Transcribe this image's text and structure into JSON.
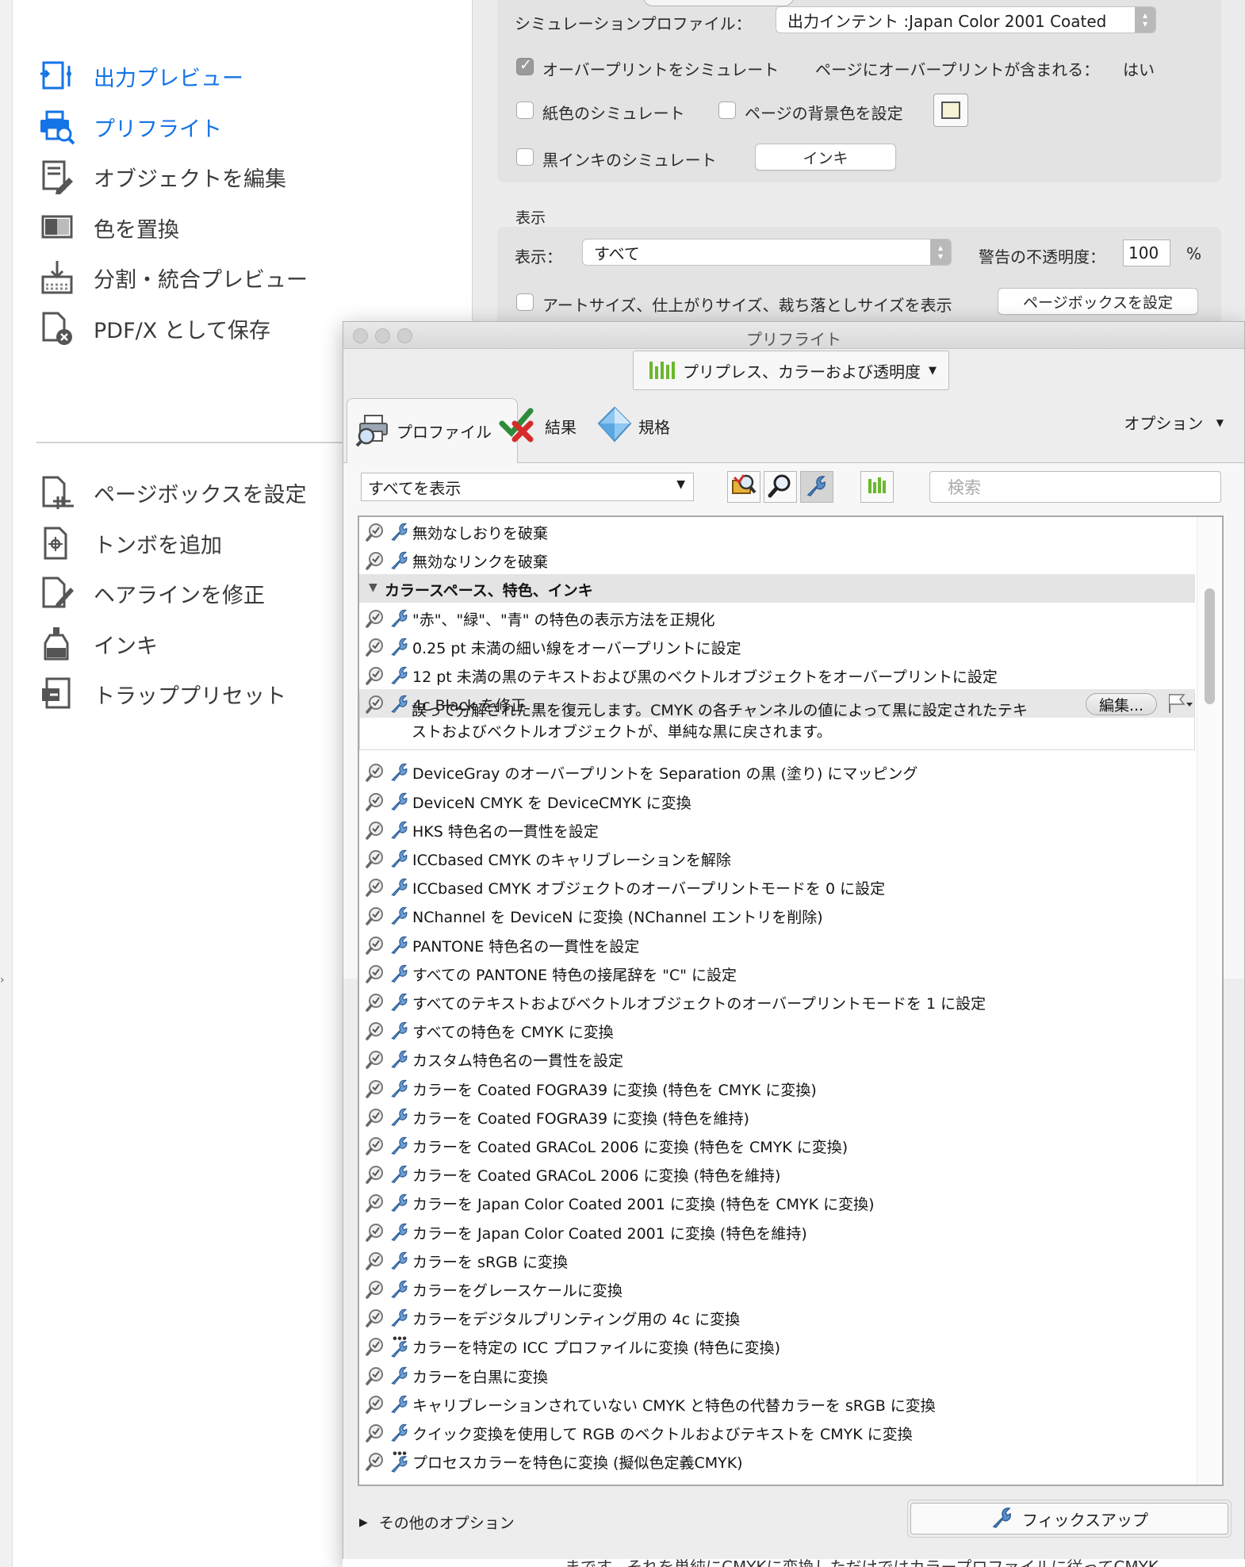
{
  "sidebar": {
    "items": [
      {
        "label": "出力プレビュー",
        "icon": "output-preview-icon",
        "active": true
      },
      {
        "label": "プリフライト",
        "icon": "preflight-icon",
        "active": true
      },
      {
        "label": "オブジェクトを編集",
        "icon": "edit-object-icon",
        "active": false
      },
      {
        "label": "色を置換",
        "icon": "replace-color-icon",
        "active": false
      },
      {
        "label": "分割・統合プレビュー",
        "icon": "flattener-preview-icon",
        "active": false
      },
      {
        "label": "PDF/X として保存",
        "icon": "save-pdfx-icon",
        "active": false
      },
      {
        "label": "ページボックスを設定",
        "icon": "page-box-icon",
        "active": false
      },
      {
        "label": "トンボを追加",
        "icon": "printer-marks-icon",
        "active": false
      },
      {
        "label": "ヘアラインを修正",
        "icon": "fix-hairline-icon",
        "active": false
      },
      {
        "label": "インキ",
        "icon": "ink-icon",
        "active": false
      },
      {
        "label": "トラッププリセット",
        "icon": "trap-preset-icon",
        "active": false
      }
    ],
    "accent": "#1473e6"
  },
  "output_preview": {
    "sim_profile_label": "シミュレーションプロファイル：",
    "sim_profile_value": "出力インテント :Japan Color 2001 Coated",
    "overprint_label": "オーバープリントをシミュレート",
    "overprint_checked": true,
    "contains_overprint_label": "ページにオーバープリントが含まれる：",
    "contains_overprint_value": "はい",
    "paper_color_label": "紙色のシミュレート",
    "page_bg_label": "ページの背景色を設定",
    "black_ink_label": "黒インキのシミュレート",
    "ink_button": "インキ",
    "display_section": "表示",
    "display_label": "表示：",
    "display_value": "すべて",
    "warning_opacity_label": "警告の不透明度：",
    "warning_opacity_value": "100",
    "percent": "%",
    "art_trim_label": "アートサイズ、仕上がりサイズ、裁ち落としサイズを表示",
    "page_box_button": "ページボックスを設定"
  },
  "preflight": {
    "window_title": "プリフライト",
    "profile_dropdown": "プリプレス、カラーおよび透明度",
    "tabs": [
      {
        "label": "プロファイル",
        "icon": "profile-icon"
      },
      {
        "label": "結果",
        "icon": "results-check-x-icon"
      },
      {
        "label": "規格",
        "icon": "standards-diamond-icon"
      }
    ],
    "options_label": "オプション",
    "show_filter": "すべてを表示",
    "search_placeholder": "検索",
    "rows": [
      {
        "text": "無効なしおりを破棄",
        "icon": "wrench"
      },
      {
        "text": "無効なリンクを破棄",
        "icon": "wrench"
      },
      {
        "text": "カラースペース、特色、インキ",
        "section": true
      },
      {
        "text": "\"赤\"、\"緑\"、\"青\" の特色の表示方法を正規化",
        "icon": "wrench"
      },
      {
        "text": "0.25 pt 未満の細い線をオーバープリントに設定",
        "icon": "wrench"
      },
      {
        "text": "12 pt 未満の黒のテキストおよび黒のベクトルオブジェクトをオーバープリントに設定",
        "icon": "wrench"
      },
      {
        "text": "4c Black を修正",
        "icon": "wrench",
        "selected": true
      },
      {
        "text": "DeviceGray のオーバープリントを Separation の黒 (塗り) にマッピング",
        "icon": "wrench"
      },
      {
        "text": "DeviceN CMYK を DeviceCMYK に変換",
        "icon": "wrench"
      },
      {
        "text": "HKS 特色名の一貫性を設定",
        "icon": "wrench"
      },
      {
        "text": "ICCbased CMYK のキャリブレーションを解除",
        "icon": "wrench"
      },
      {
        "text": "ICCbased CMYK オブジェクトのオーバープリントモードを 0 に設定",
        "icon": "wrench"
      },
      {
        "text": "NChannel を DeviceN に変換 (NChannel エントリを削除)",
        "icon": "wrench"
      },
      {
        "text": "PANTONE 特色名の一貫性を設定",
        "icon": "wrench"
      },
      {
        "text": "すべての PANTONE 特色の接尾辞を \"C\" に設定",
        "icon": "wrench"
      },
      {
        "text": "すべてのテキストおよびベクトルオブジェクトのオーバープリントモードを 1 に設定",
        "icon": "wrench"
      },
      {
        "text": "すべての特色を CMYK に変換",
        "icon": "wrench"
      },
      {
        "text": "カスタム特色名の一貫性を設定",
        "icon": "wrench"
      },
      {
        "text": "カラーを Coated FOGRA39 に変換 (特色を CMYK に変換)",
        "icon": "wrench"
      },
      {
        "text": "カラーを Coated FOGRA39 に変換 (特色を維持)",
        "icon": "wrench"
      },
      {
        "text": "カラーを Coated GRACoL 2006 に変換 (特色を CMYK に変換)",
        "icon": "wrench"
      },
      {
        "text": "カラーを Coated GRACoL 2006 に変換 (特色を維持)",
        "icon": "wrench"
      },
      {
        "text": "カラーを Japan Color Coated 2001 に変換 (特色を CMYK に変換)",
        "icon": "wrench"
      },
      {
        "text": "カラーを Japan Color Coated 2001 に変換 (特色を維持)",
        "icon": "wrench"
      },
      {
        "text": "カラーを sRGB に変換",
        "icon": "wrench"
      },
      {
        "text": "カラーをグレースケールに変換",
        "icon": "wrench"
      },
      {
        "text": "カラーをデジタルプリンティング用の 4c に変換",
        "icon": "wrench"
      },
      {
        "text": "カラーを特定の ICC プロファイルに変換 (特色に変換)",
        "icon": "wrench-dots"
      },
      {
        "text": "カラーを白黒に変換",
        "icon": "wrench"
      },
      {
        "text": "キャリブレーションされていない CMYK と特色の代替カラーを sRGB に変換",
        "icon": "wrench"
      },
      {
        "text": "クイック変換を使用して RGB のベクトルおよびテキストを CMYK に変換",
        "icon": "wrench"
      },
      {
        "text": "プロセスカラーを特色に変換 (擬似色定義CMYK)",
        "icon": "wrench-dots"
      }
    ],
    "selected_detail": "誤って分解された黒を復元します。CMYK の各チャンネルの値によって黒に設定されたテキストおよびベクトルオブジェクトが、単純な黒に戻されます。",
    "edit_button": "編集...",
    "more_options": "その他のオプション",
    "fixup_button": "フィックスアップ"
  },
  "background_text": "まです。それを単純にCMYKに変換しただけではカラープロファイルに従ってCMYK"
}
